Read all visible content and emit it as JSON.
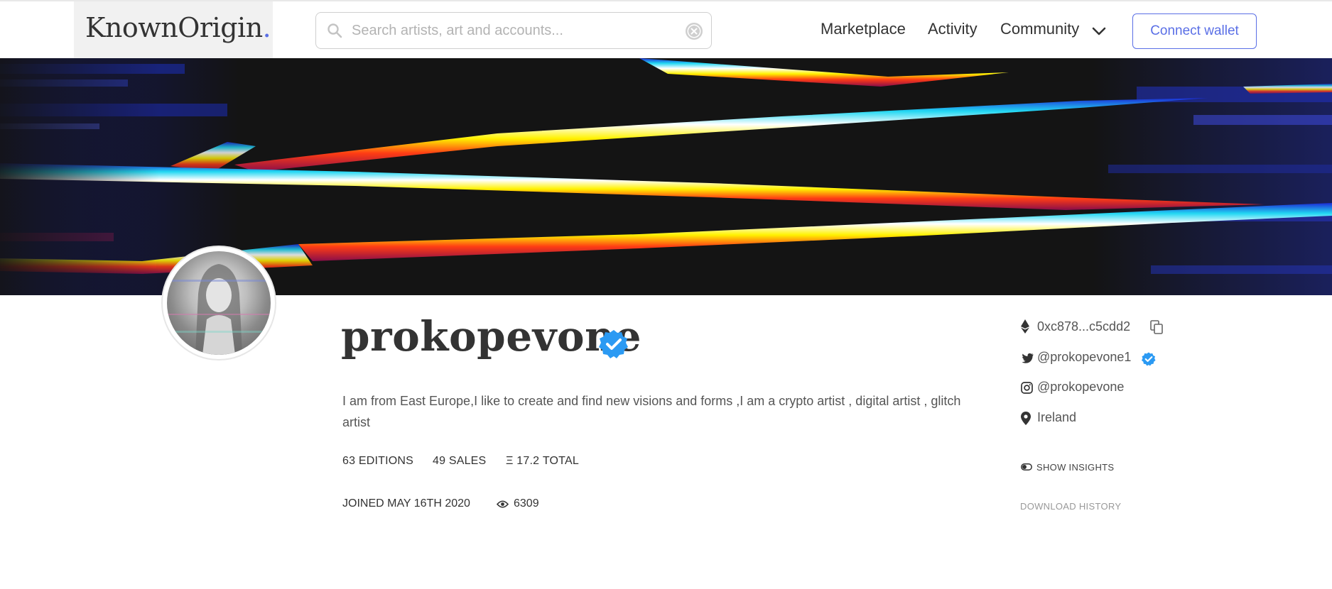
{
  "header": {
    "logo_text": "KnownOrigin",
    "logo_dot": ".",
    "search_placeholder": "Search artists, art and accounts...",
    "search_value": "",
    "nav": {
      "marketplace": "Marketplace",
      "activity": "Activity",
      "community": "Community"
    },
    "connect_wallet": "Connect wallet"
  },
  "profile": {
    "username": "prokopevone",
    "verified": true,
    "bio": "I am from East Europe,I like to create and find new visions and forms ,I am a crypto artist , digital artist , glitch artist",
    "stats": {
      "editions": "63 EDITIONS",
      "sales": "49 SALES",
      "total": "Ξ 17.2 TOTAL"
    },
    "joined": "JOINED MAY 16TH 2020",
    "views": "6309"
  },
  "sidebar": {
    "wallet": "0xc878...c5cdd2",
    "twitter": "@prokopevone1",
    "twitter_verified": true,
    "instagram": "@prokopevone",
    "location": "Ireland",
    "show_insights": "SHOW INSIGHTS",
    "download_history": "DOWNLOAD HISTORY"
  },
  "colors": {
    "accent": "#5a6fe6",
    "verified": "#2b9af3",
    "text": "#333333",
    "muted": "#999999"
  },
  "icons": [
    "search-icon",
    "clear-icon",
    "chevron-down-icon",
    "verified-icon",
    "ethereum-icon",
    "copy-icon",
    "twitter-icon",
    "instagram-icon",
    "location-pin-icon",
    "toggle-icon",
    "eye-icon"
  ]
}
